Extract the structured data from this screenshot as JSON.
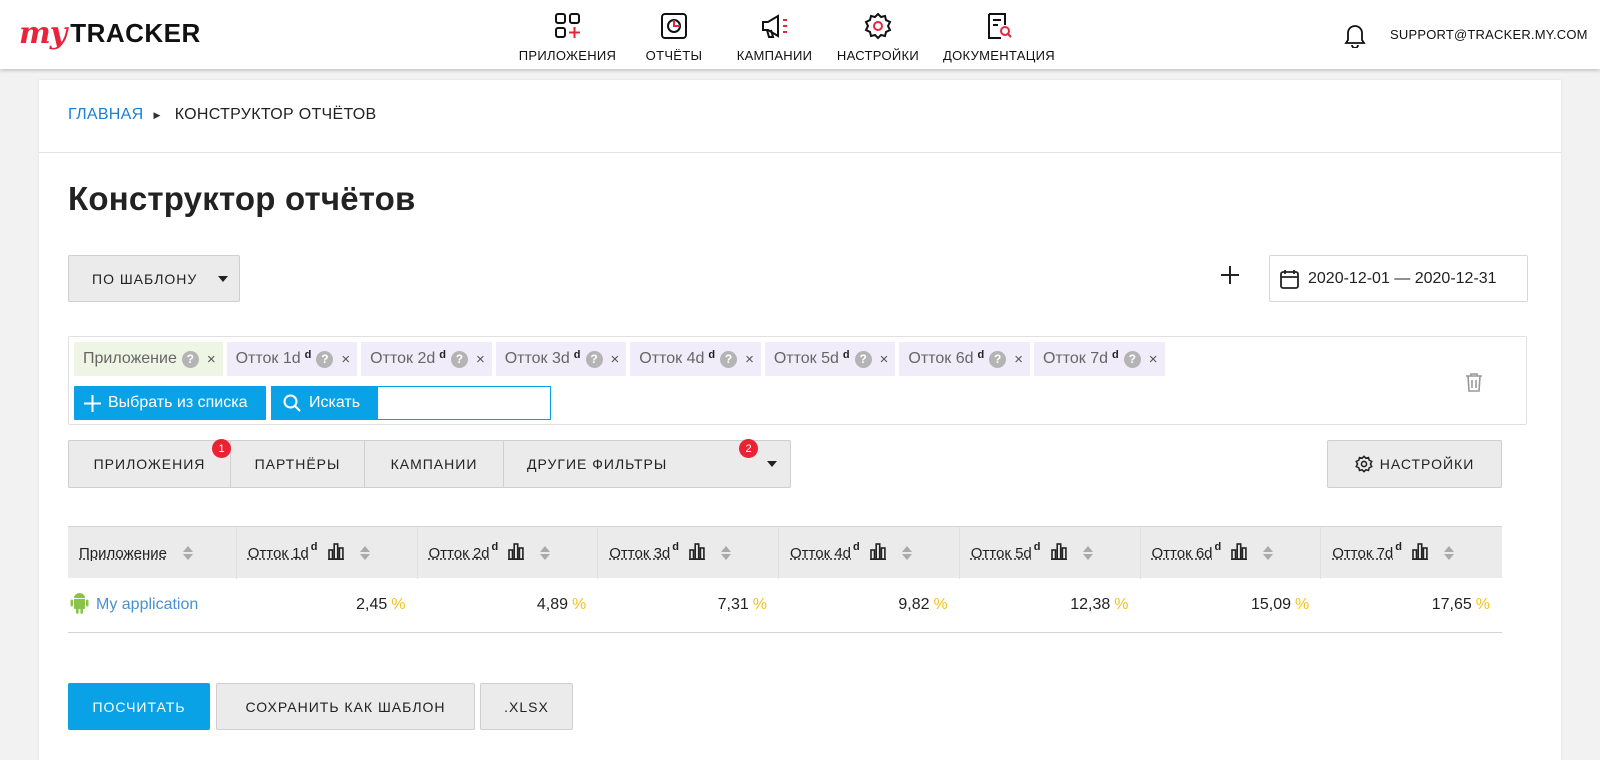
{
  "brand": {
    "logo_script": "my",
    "logo_text": "TRACKER"
  },
  "nav": [
    {
      "label": "ПРИЛОЖЕНИЯ",
      "icon": "apps-add-icon"
    },
    {
      "label": "ОТЧЁТЫ",
      "icon": "report-chart-icon"
    },
    {
      "label": "КАМПАНИИ",
      "icon": "megaphone-icon"
    },
    {
      "label": "НАСТРОЙКИ",
      "icon": "gear-icon"
    },
    {
      "label": "ДОКУМЕНТАЦИЯ",
      "icon": "document-search-icon"
    }
  ],
  "user": {
    "email": "SUPPORT@TRACKER.MY.COM"
  },
  "breadcrumb": {
    "home": "ГЛАВНАЯ",
    "current": "КОНСТРУКТОР ОТЧЁТОВ"
  },
  "page_title": "Конструктор отчётов",
  "template_select": {
    "label": "ПО ШАБЛОНУ"
  },
  "date_range": {
    "value": "2020-12-01 — 2020-12-31"
  },
  "metrics": {
    "chips": [
      {
        "label": "Приложение",
        "sup": "",
        "kind": "app"
      },
      {
        "label": "Отток 1d",
        "sup": "d",
        "kind": "churn"
      },
      {
        "label": "Отток 2d",
        "sup": "d",
        "kind": "churn"
      },
      {
        "label": "Отток 3d",
        "sup": "d",
        "kind": "churn"
      },
      {
        "label": "Отток 4d",
        "sup": "d",
        "kind": "churn"
      },
      {
        "label": "Отток 5d",
        "sup": "d",
        "kind": "churn"
      },
      {
        "label": "Отток 6d",
        "sup": "d",
        "kind": "churn"
      },
      {
        "label": "Отток 7d",
        "sup": "d",
        "kind": "churn"
      }
    ],
    "help_glyph": "?",
    "remove_glyph": "×",
    "pick_label": "Выбрать из списка",
    "search_label": "Искать",
    "search_value": ""
  },
  "filters": {
    "tabs": [
      {
        "label": "ПРИЛОЖЕНИЯ",
        "badge": "1"
      },
      {
        "label": "ПАРТНЁРЫ",
        "badge": ""
      },
      {
        "label": "КАМПАНИИ",
        "badge": ""
      },
      {
        "label": "ДРУГИЕ ФИЛЬТРЫ",
        "badge": "2"
      }
    ],
    "settings_label": "НАСТРОЙКИ"
  },
  "table": {
    "columns": [
      {
        "label": "Приложение",
        "sup": ""
      },
      {
        "label": "Отток 1d",
        "sup": "d"
      },
      {
        "label": "Отток 2d",
        "sup": "d"
      },
      {
        "label": "Отток 3d",
        "sup": "d"
      },
      {
        "label": "Отток 4d",
        "sup": "d"
      },
      {
        "label": "Отток 5d",
        "sup": "d"
      },
      {
        "label": "Отток 6d",
        "sup": "d"
      },
      {
        "label": "Отток 7d",
        "sup": "d"
      }
    ],
    "rows": [
      {
        "app": "My application",
        "platform_icon": "android-icon",
        "values": [
          "2,45",
          "4,89",
          "7,31",
          "9,82",
          "12,38",
          "15,09",
          "17,65"
        ],
        "unit": "%"
      }
    ]
  },
  "actions": {
    "calculate": "ПОСЧИТАТЬ",
    "save_template": "СОХРАНИТЬ КАК ШАБЛОН",
    "export": ".XLSX"
  },
  "colors": {
    "accent": "#0aa2e6",
    "link": "#1d7ed4",
    "badge": "#ea2233",
    "percent": "#f3c318",
    "brand_red": "#e8243c"
  }
}
